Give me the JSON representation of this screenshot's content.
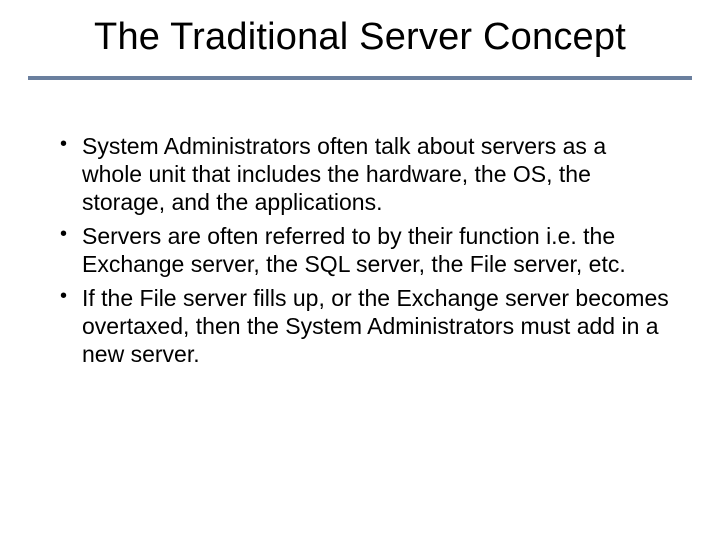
{
  "title": "The Traditional Server Concept",
  "bullets": [
    "System Administrators often talk about servers as a whole unit that includes the hardware, the OS, the storage, and the applications.",
    "Servers are often referred to by their function i.e. the Exchange server, the SQL server, the File server, etc.",
    "If the File server fills up, or the Exchange server becomes overtaxed, then the System Administrators must add in a new server."
  ]
}
